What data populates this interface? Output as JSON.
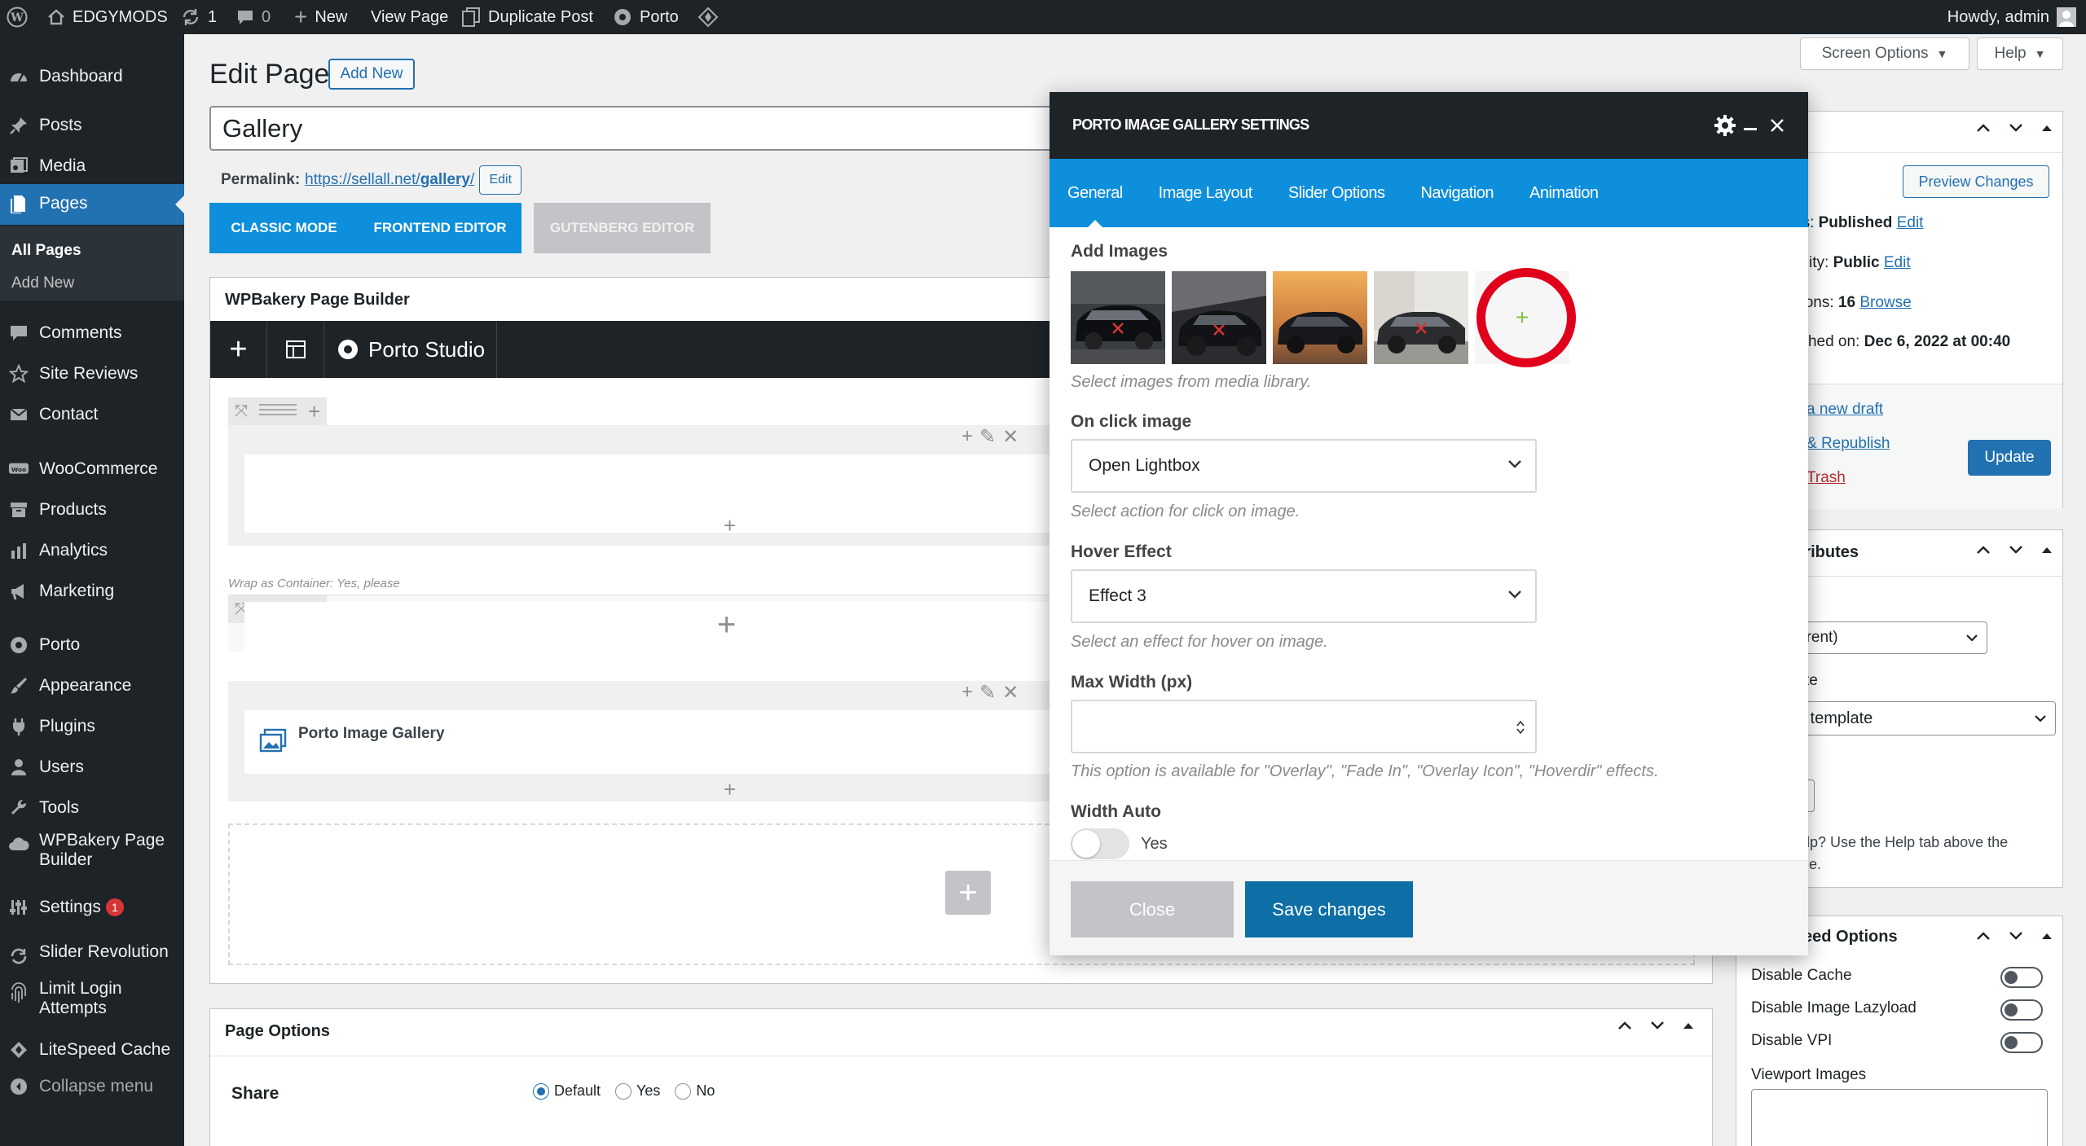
{
  "adminbar": {
    "site_name": "EDGYMODS",
    "updates_count": "1",
    "comments_count": "0",
    "new_label": "New",
    "view_page": "View Page",
    "duplicate_post": "Duplicate Post",
    "porto": "Porto",
    "howdy": "Howdy, admin"
  },
  "sidebar": {
    "items": [
      {
        "label": "Dashboard",
        "icon": "dashboard-icon"
      },
      {
        "label": "Posts",
        "icon": "pin-icon"
      },
      {
        "label": "Media",
        "icon": "media-icon"
      },
      {
        "label": "Pages",
        "icon": "page-icon"
      },
      {
        "label": "Comments",
        "icon": "comment-icon"
      },
      {
        "label": "Site Reviews",
        "icon": "star-icon"
      },
      {
        "label": "Contact",
        "icon": "mail-icon"
      },
      {
        "label": "WooCommerce",
        "icon": "woo-icon"
      },
      {
        "label": "Products",
        "icon": "archive-icon"
      },
      {
        "label": "Analytics",
        "icon": "bar-chart-icon"
      },
      {
        "label": "Marketing",
        "icon": "megaphone-icon"
      },
      {
        "label": "Porto",
        "icon": "porto-icon"
      },
      {
        "label": "Appearance",
        "icon": "brush-icon"
      },
      {
        "label": "Plugins",
        "icon": "plug-icon"
      },
      {
        "label": "Users",
        "icon": "user-icon"
      },
      {
        "label": "Tools",
        "icon": "wrench-icon"
      },
      {
        "label": "WPBakery Page Builder",
        "icon": "cloud-icon"
      },
      {
        "label": "Settings",
        "icon": "sliders-icon",
        "badge": "1"
      },
      {
        "label": "Slider Revolution",
        "icon": "refresh-icon"
      },
      {
        "label": "Limit Login Attempts",
        "icon": "fingerprint-icon"
      },
      {
        "label": "LiteSpeed Cache",
        "icon": "diamond-icon"
      },
      {
        "label": "Collapse menu",
        "icon": "collapse-icon"
      }
    ],
    "sub_all_pages": "All Pages",
    "sub_add_new": "Add New"
  },
  "header": {
    "screen_options": "Screen Options",
    "help": "Help",
    "edit_page": "Edit Page",
    "add_new": "Add New"
  },
  "editor": {
    "title": "Gallery",
    "permalink_label": "Permalink:",
    "permalink_url": "https://sellall.net/",
    "permalink_slug": "gallery",
    "permalink_edit": "Edit",
    "classic_mode": "Classic Mode",
    "frontend_editor": "Frontend Editor",
    "gutenberg_editor": "Gutenberg Editor",
    "wpb_title": "WPBakery Page Builder",
    "porto_studio": "Porto Studio",
    "wrap_container": "Wrap as Container: Yes, please",
    "gallery_element": "Porto Image Gallery"
  },
  "page_options": {
    "title": "Page Options",
    "share_label": "Share",
    "share_options": [
      "Default",
      "Yes",
      "No"
    ],
    "share_selected": "Default"
  },
  "modal": {
    "title": "PORTO IMAGE GALLERY SETTINGS",
    "tabs": [
      "General",
      "Image Layout",
      "Slider Options",
      "Navigation",
      "Animation"
    ],
    "active_tab": "General",
    "add_images_label": "Add Images",
    "add_images_desc": "Select images from media library.",
    "on_click_label": "On click image",
    "on_click_value": "Open Lightbox",
    "on_click_desc": "Select action for click on image.",
    "hover_label": "Hover Effect",
    "hover_value": "Effect 3",
    "hover_desc": "Select an effect for hover on image.",
    "max_width_label": "Max Width (px)",
    "max_width_value": "",
    "max_width_desc": "This option is available for \"Overlay\", \"Fade In\", \"Overlay Icon\", \"Hoverdir\" effects.",
    "width_auto_label": "Width Auto",
    "width_auto_toggle": "Yes",
    "close_button": "Close",
    "save_button": "Save changes"
  },
  "publish": {
    "preview_changes": "Preview Changes",
    "status_prefix": "us: ",
    "status_value": "Published",
    "status_edit": "Edit",
    "visibility_prefix": "bility: ",
    "visibility_value": "Public",
    "visibility_edit": "Edit",
    "revisions_prefix": "sions: ",
    "revisions_value": "16",
    "revisions_browse": "Browse",
    "published_prefix": "lished on: ",
    "published_value": "Dec 6, 2022 at 00:40",
    "new_draft": "a new draft",
    "republish": "& Republish",
    "trash": "Trash",
    "update": "Update"
  },
  "attributes": {
    "title": "ttributes",
    "parent_value": "arent)",
    "template_label": "te",
    "template_value": "lt template",
    "help_text_1": "elp? Use the Help tab above the",
    "help_text_2": "itle."
  },
  "speed": {
    "title": "eed Options",
    "disable_cache": "Disable Cache",
    "disable_lazyload": "Disable Image Lazyload",
    "disable_vpi": "Disable VPI",
    "viewport_images": "Viewport Images"
  },
  "colors": {
    "wp_blue": "#2271b1",
    "admin_dark": "#1d2327",
    "modal_tab_blue": "#0d8fdb",
    "highlight_red": "#e0001b",
    "add_plus_green": "#7cc443"
  }
}
